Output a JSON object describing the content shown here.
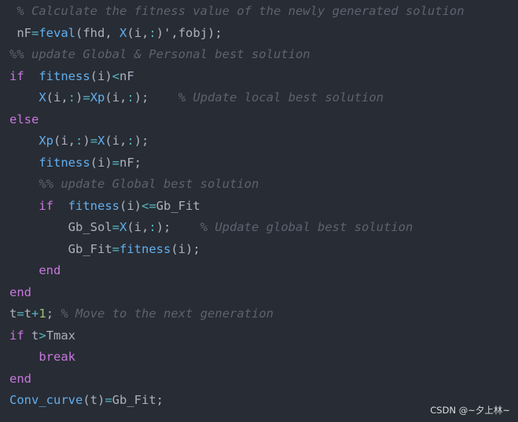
{
  "colors": {
    "background": "#282c34",
    "keyword": "#c678dd",
    "function": "#61afef",
    "operator": "#56b6c2",
    "number": "#98c379",
    "plain": "#abb2bf",
    "comment": "#5c6370"
  },
  "code_lines": [
    [
      {
        "t": " ",
        "c": "pl"
      },
      {
        "t": "% Calculate the fitness value of the newly generated solution",
        "c": "cm"
      }
    ],
    [
      {
        "t": " nF",
        "c": "pl"
      },
      {
        "t": "=",
        "c": "op"
      },
      {
        "t": "feval",
        "c": "fn"
      },
      {
        "t": "(fhd, ",
        "c": "pl"
      },
      {
        "t": "X",
        "c": "fn"
      },
      {
        "t": "(i,",
        "c": "pl"
      },
      {
        "t": ":",
        "c": "op"
      },
      {
        "t": ")'",
        "c": "pl"
      },
      {
        "t": ",fobj);",
        "c": "pl"
      }
    ],
    [
      {
        "t": "%% update Global & Personal best solution",
        "c": "cm"
      }
    ],
    [
      {
        "t": "if",
        "c": "kw"
      },
      {
        "t": "  ",
        "c": "pl"
      },
      {
        "t": "fitness",
        "c": "fn"
      },
      {
        "t": "(i)",
        "c": "pl"
      },
      {
        "t": "<",
        "c": "op"
      },
      {
        "t": "nF",
        "c": "pl"
      }
    ],
    [
      {
        "t": "    ",
        "c": "pl"
      },
      {
        "t": "X",
        "c": "fn"
      },
      {
        "t": "(i,",
        "c": "pl"
      },
      {
        "t": ":",
        "c": "op"
      },
      {
        "t": ")",
        "c": "pl"
      },
      {
        "t": "=",
        "c": "op"
      },
      {
        "t": "Xp",
        "c": "fn"
      },
      {
        "t": "(i,",
        "c": "pl"
      },
      {
        "t": ":",
        "c": "op"
      },
      {
        "t": ");    ",
        "c": "pl"
      },
      {
        "t": "% Update local best solution",
        "c": "cm"
      }
    ],
    [
      {
        "t": "else",
        "c": "kw"
      }
    ],
    [
      {
        "t": "    ",
        "c": "pl"
      },
      {
        "t": "Xp",
        "c": "fn"
      },
      {
        "t": "(i,",
        "c": "pl"
      },
      {
        "t": ":",
        "c": "op"
      },
      {
        "t": ")",
        "c": "pl"
      },
      {
        "t": "=",
        "c": "op"
      },
      {
        "t": "X",
        "c": "fn"
      },
      {
        "t": "(i,",
        "c": "pl"
      },
      {
        "t": ":",
        "c": "op"
      },
      {
        "t": ");",
        "c": "pl"
      }
    ],
    [
      {
        "t": "    ",
        "c": "pl"
      },
      {
        "t": "fitness",
        "c": "fn"
      },
      {
        "t": "(i)",
        "c": "pl"
      },
      {
        "t": "=",
        "c": "op"
      },
      {
        "t": "nF;",
        "c": "pl"
      }
    ],
    [
      {
        "t": "    ",
        "c": "pl"
      },
      {
        "t": "%% update Global best solution",
        "c": "cm"
      }
    ],
    [
      {
        "t": "    ",
        "c": "pl"
      },
      {
        "t": "if",
        "c": "kw"
      },
      {
        "t": "  ",
        "c": "pl"
      },
      {
        "t": "fitness",
        "c": "fn"
      },
      {
        "t": "(i)",
        "c": "pl"
      },
      {
        "t": "<=",
        "c": "op"
      },
      {
        "t": "Gb_Fit",
        "c": "pl"
      }
    ],
    [
      {
        "t": "        ",
        "c": "pl"
      },
      {
        "t": "Gb_Sol",
        "c": "pl"
      },
      {
        "t": "=",
        "c": "op"
      },
      {
        "t": "X",
        "c": "fn"
      },
      {
        "t": "(i,",
        "c": "pl"
      },
      {
        "t": ":",
        "c": "op"
      },
      {
        "t": ");    ",
        "c": "pl"
      },
      {
        "t": "% Update global best solution",
        "c": "cm"
      }
    ],
    [
      {
        "t": "        ",
        "c": "pl"
      },
      {
        "t": "Gb_Fit",
        "c": "pl"
      },
      {
        "t": "=",
        "c": "op"
      },
      {
        "t": "fitness",
        "c": "fn"
      },
      {
        "t": "(i);",
        "c": "pl"
      }
    ],
    [
      {
        "t": "    ",
        "c": "pl"
      },
      {
        "t": "end",
        "c": "kw"
      }
    ],
    [
      {
        "t": "end",
        "c": "kw"
      }
    ],
    [
      {
        "t": "t",
        "c": "pl"
      },
      {
        "t": "=",
        "c": "op"
      },
      {
        "t": "t",
        "c": "pl"
      },
      {
        "t": "+",
        "c": "op"
      },
      {
        "t": "1",
        "c": "num"
      },
      {
        "t": "; ",
        "c": "pl"
      },
      {
        "t": "% Move to the next generation",
        "c": "cm"
      }
    ],
    [
      {
        "t": "if",
        "c": "kw"
      },
      {
        "t": " t",
        "c": "pl"
      },
      {
        "t": ">",
        "c": "op"
      },
      {
        "t": "Tmax",
        "c": "pl"
      }
    ],
    [
      {
        "t": "    ",
        "c": "pl"
      },
      {
        "t": "break",
        "c": "kw"
      }
    ],
    [
      {
        "t": "end",
        "c": "kw"
      }
    ],
    [
      {
        "t": "Conv_curve",
        "c": "fn"
      },
      {
        "t": "(t)",
        "c": "pl"
      },
      {
        "t": "=",
        "c": "op"
      },
      {
        "t": "Gb_Fit;",
        "c": "pl"
      }
    ]
  ],
  "watermark": "CSDN @~夕上林~"
}
